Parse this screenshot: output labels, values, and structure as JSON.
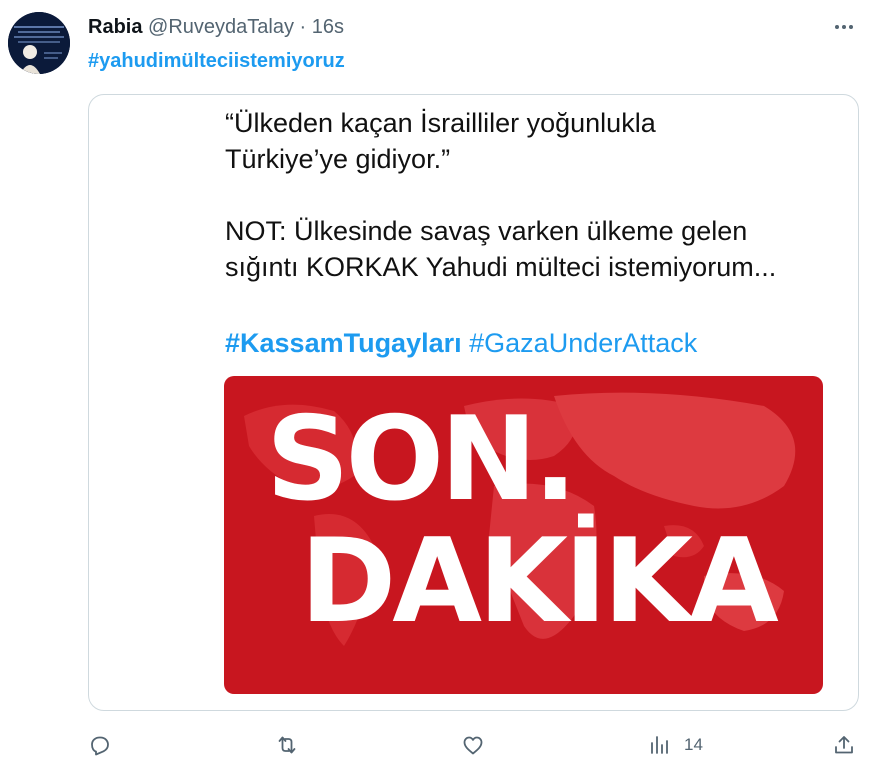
{
  "tweet": {
    "author_name": "Rabia",
    "author_handle": "@RuveydaTalay",
    "separator": "·",
    "time": "16s",
    "hashtag": "#yahudimülteciistemiyoruz"
  },
  "quoted": {
    "text": "“Ülkeden kaçan İsrailliler yoğunlukla\nTürkiye’ye gidiyor.”\n\nNOT: Ülkesinde savaş varken ülkeme gelen\nsığıntı KORKAK Yahudi mülteci istemiyorum...",
    "tag_1": "#KassamTugayları",
    "tag_2": "#GazaUnderAttack",
    "image": {
      "line_1": "SON.",
      "line_2": "DAKİKA",
      "background_color": "#c8161f",
      "map_color": "#e0343a"
    }
  },
  "actions": {
    "reply_icon": "reply-icon",
    "retweet_icon": "retweet-icon",
    "like_icon": "heart-icon",
    "views_icon": "views-icon",
    "views_count": "14",
    "share_icon": "share-icon"
  },
  "colors": {
    "accent": "#1d9bf0",
    "secondary_text": "#536471",
    "border": "#cfd9de"
  }
}
